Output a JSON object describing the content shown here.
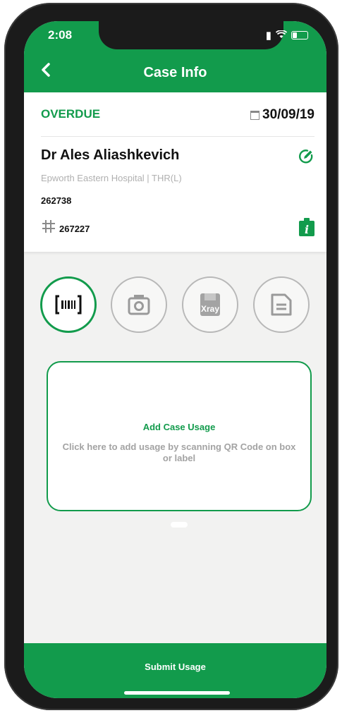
{
  "status_bar": {
    "time": "2:08"
  },
  "header": {
    "title": "Case Info"
  },
  "case": {
    "status": "OVERDUE",
    "date": "30/09/19",
    "doctor": "Dr Ales Aliashkevich",
    "hospital": "Epworth Eastern Hospital | THR(L)",
    "case_id": "262738",
    "reference": "267227"
  },
  "usage_icons": [
    "barcode-scan-icon",
    "camera-icon",
    "xray-icon",
    "document-icon"
  ],
  "xray_label": "Xray",
  "usage_box": {
    "title": "Add Case Usage",
    "description": "Click here to add usage by scanning QR Code on box or label"
  },
  "submit_label": "Submit Usage",
  "colors": {
    "accent": "#129b4c",
    "background": "#f2f2f1"
  }
}
